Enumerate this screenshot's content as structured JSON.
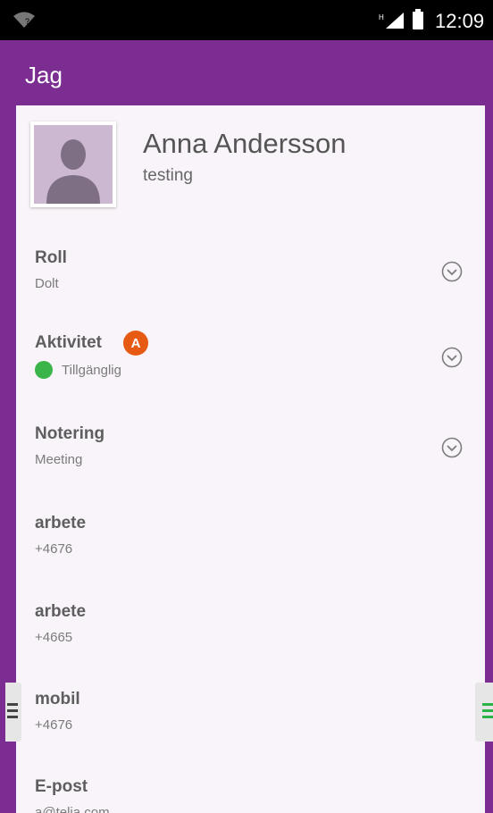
{
  "status_bar": {
    "time": "12:09",
    "network_letter": "H"
  },
  "app_bar": {
    "title": "Jag"
  },
  "profile": {
    "name": "Anna Andersson",
    "subtitle": "testing"
  },
  "fields": [
    {
      "label": "Roll",
      "value": "Dolt",
      "expandable": true
    },
    {
      "label": "Aktivitet",
      "value": "Tillgänglig",
      "status_color": "#3bb54a",
      "expandable": true,
      "badge": "A"
    },
    {
      "label": "Notering",
      "value": "Meeting",
      "expandable": true
    },
    {
      "label": "arbete",
      "value": "+4676"
    },
    {
      "label": "arbete",
      "value": "+4665"
    },
    {
      "label": "mobil",
      "value": "+4676"
    },
    {
      "label": "E-post",
      "value": "a@telia.com"
    }
  ],
  "colors": {
    "brand": "#7b2d91",
    "status_available": "#3bb54a",
    "badge": "#e65a14"
  }
}
